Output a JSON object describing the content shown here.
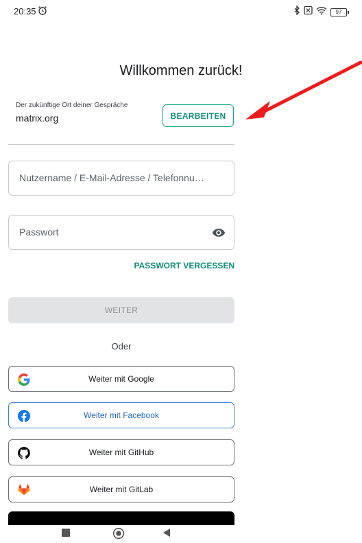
{
  "status_bar": {
    "time": "20:35",
    "battery": "97",
    "icons": [
      "alarm-icon",
      "bluetooth-icon",
      "sim-icon",
      "wifi-icon",
      "battery-icon"
    ]
  },
  "title": "Willkommen zurück!",
  "server": {
    "label": "Der zukünftige Ort deiner Gespräche",
    "value": "matrix.org",
    "edit_label": "BEARBEITEN"
  },
  "fields": {
    "username_placeholder": "Nutzername / E-Mail-Adresse / Telefonnu…",
    "password_placeholder": "Passwort"
  },
  "forgot_password": "PASSWORT VERGESSEN",
  "continue_label": "WEITER",
  "or_label": "Oder",
  "sso": {
    "google": "Weiter mit Google",
    "facebook": "Weiter mit Facebook",
    "github": "Weiter mit GitHub",
    "gitlab": "Weiter mit GitLab"
  },
  "colors": {
    "accent": "#0f8f7a",
    "facebook": "#1f67c4",
    "annotation_arrow": "#ee1c1c"
  },
  "navbar": {
    "icons": [
      "recents-icon",
      "home-icon",
      "back-icon"
    ]
  }
}
